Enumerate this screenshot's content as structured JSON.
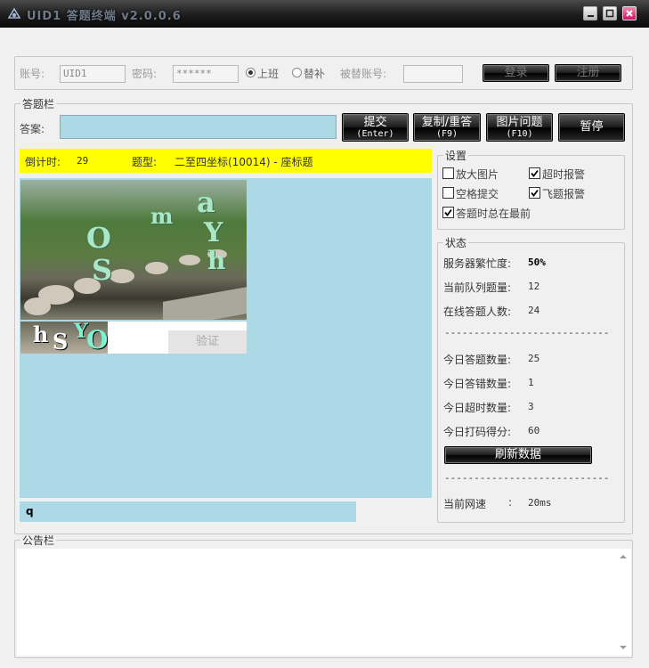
{
  "window": {
    "title": "UID1 答题终端 v2.0.0.6"
  },
  "login": {
    "account_label": "账号:",
    "account_value": "UID1",
    "password_label": "密码:",
    "password_value": "******",
    "radio_on_duty": "上班",
    "radio_substitute": "替补",
    "radio_selected": "上班",
    "substitute_account_label": "被替账号:",
    "substitute_account_value": "",
    "login_button": "登录",
    "register_button": "注册"
  },
  "answer": {
    "group_label": "答题栏",
    "answer_label": "答案:",
    "answer_value": "",
    "submit_label": "提交",
    "submit_key": "(Enter)",
    "copy_label": "复制/重答",
    "copy_key": "(F9)",
    "image_issue_label": "图片问题",
    "image_issue_key": "(F10)",
    "pause_label": "暂停"
  },
  "question": {
    "countdown_label": "倒计时:",
    "countdown_value": "29",
    "type_label": "题型:",
    "type_value": "二至四坐标(10014) - 座标题",
    "verify_button": "验证",
    "captcha_letters": [
      "a",
      "m",
      "O",
      "Y",
      "S",
      "h"
    ],
    "captcha_small_letters": [
      "h",
      "S",
      "Y",
      "O"
    ],
    "input_echo": "q"
  },
  "settings": {
    "group_label": "设置",
    "options": [
      {
        "label": "放大图片",
        "checked": false
      },
      {
        "label": "超时报警",
        "checked": true
      },
      {
        "label": "空格提交",
        "checked": false
      },
      {
        "label": "飞题报警",
        "checked": true
      },
      {
        "label": "答题时总在最前",
        "checked": true
      }
    ]
  },
  "status": {
    "group_label": "状态",
    "rows": [
      {
        "label": "服务器繁忙度:",
        "value": "50%"
      },
      {
        "label": "当前队列题量:",
        "value": "12"
      },
      {
        "label": "在线答题人数:",
        "value": "24"
      },
      {
        "label": "今日答题数量:",
        "value": "25"
      },
      {
        "label": "今日答错数量:",
        "value": "1"
      },
      {
        "label": "今日超时数量:",
        "value": "3"
      },
      {
        "label": "今日打码得分:",
        "value": "60"
      }
    ],
    "separator": "----------------------------",
    "refresh_button": "刷新数据",
    "speed_label": "当前网速",
    "speed_colon": ":",
    "speed_value": "20ms"
  },
  "notice": {
    "group_label": "公告栏"
  }
}
